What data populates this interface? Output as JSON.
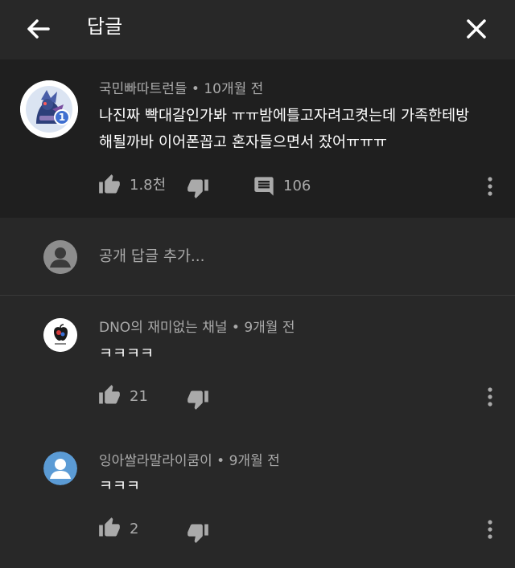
{
  "header": {
    "title": "답글"
  },
  "parent_comment": {
    "author": "국민빠따트런들",
    "time": "10개월 전",
    "badge": "1",
    "text_line1": "나진짜 빡대갈인가봐 ㅠㅠ밤에틀고자려고켯는데 가족한테방",
    "text_line2": "해될까바 이어폰꼽고 혼자들으면서 잤어ㅠㅠㅠ",
    "likes": "1.8천",
    "replies": "106"
  },
  "add_reply": {
    "placeholder": "공개 답글 추가..."
  },
  "replies": [
    {
      "author": "DNO의 재미없는 채널",
      "time": "9개월 전",
      "text": "ㅋㅋㅋㅋ",
      "likes": "21"
    },
    {
      "author": "잉아쌀라말라이쿰이",
      "time": "9개월 전",
      "text": "ㅋㅋㅋ",
      "likes": "2"
    }
  ],
  "separator": " • ",
  "colors": {
    "accent_blue": "#5b9bd5",
    "muted_text": "#aaaaaa",
    "background": "#282828",
    "highlight_bg": "#1f1f1f"
  }
}
